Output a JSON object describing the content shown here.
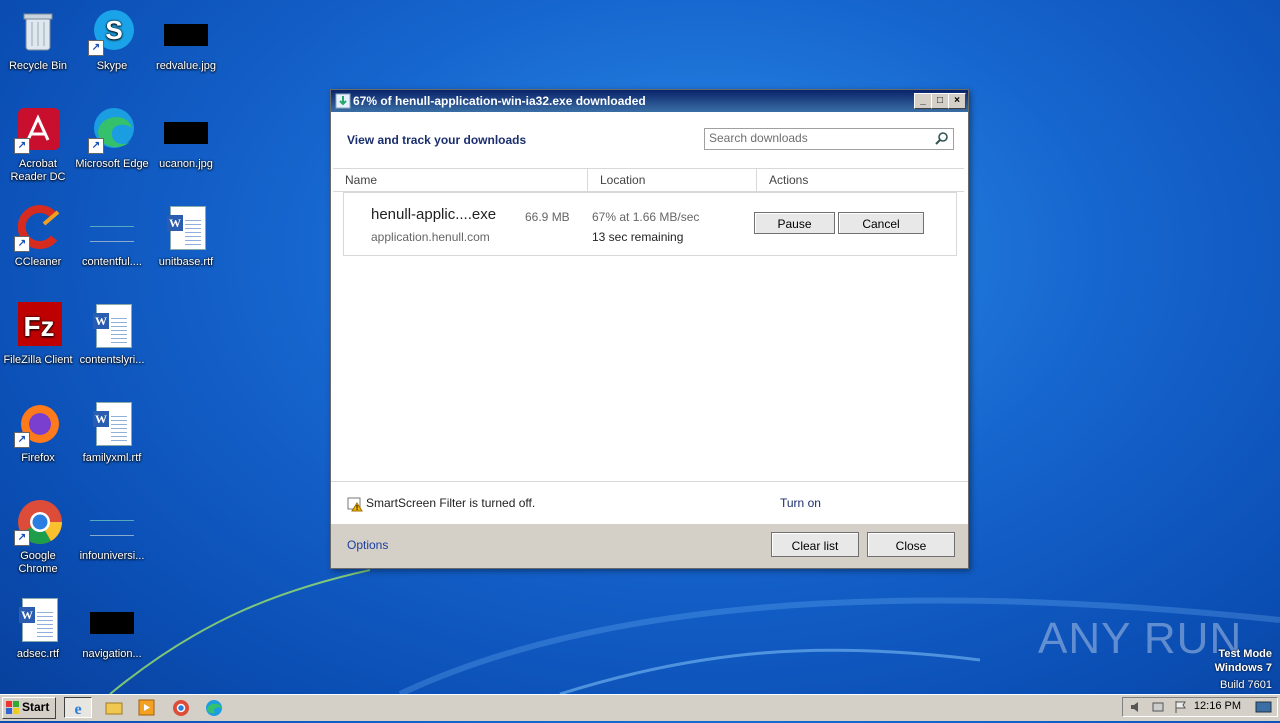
{
  "desktop": {
    "icons": [
      {
        "label": "Recycle Bin"
      },
      {
        "label": "Skype"
      },
      {
        "label": "redvalue.jpg"
      },
      {
        "label": "Acrobat Reader DC"
      },
      {
        "label": "Microsoft Edge"
      },
      {
        "label": "ucanon.jpg"
      },
      {
        "label": "CCleaner"
      },
      {
        "label": "contentful...."
      },
      {
        "label": "unitbase.rtf"
      },
      {
        "label": "FileZilla Client"
      },
      {
        "label": "contentslyri..."
      },
      {
        "label": "Firefox"
      },
      {
        "label": "familyxml.rtf"
      },
      {
        "label": "Google Chrome"
      },
      {
        "label": "infouniversi..."
      },
      {
        "label": "adsec.rtf"
      },
      {
        "label": "navigation..."
      }
    ]
  },
  "window": {
    "title": "67% of henull-application-win-ia32.exe downloaded",
    "heading": "View and track your downloads",
    "search_placeholder": "Search downloads",
    "columns": {
      "name": "Name",
      "location": "Location",
      "actions": "Actions"
    },
    "download": {
      "filename": "henull-applic....exe",
      "size": "66.9 MB",
      "host": "application.henull.com",
      "progress_text": "67% at 1.66 MB/sec",
      "remaining": "13 sec remaining",
      "pause_label": "Pause",
      "cancel_label": "Cancel"
    },
    "smartscreen": {
      "text": "SmartScreen Filter is turned off.",
      "action": "Turn on"
    },
    "footer": {
      "options": "Options",
      "clear_list": "Clear list",
      "close": "Close"
    }
  },
  "taskbar": {
    "start_label": "Start",
    "clock": "12:16 PM"
  },
  "watermark": {
    "brand": "ANY RUN",
    "line1": "Test Mode",
    "line2": "Windows 7",
    "line3": "Build 7601"
  },
  "colors": {
    "accent": "#1a2e6e",
    "desktop": "#1666cf",
    "title": "#0a246a"
  }
}
